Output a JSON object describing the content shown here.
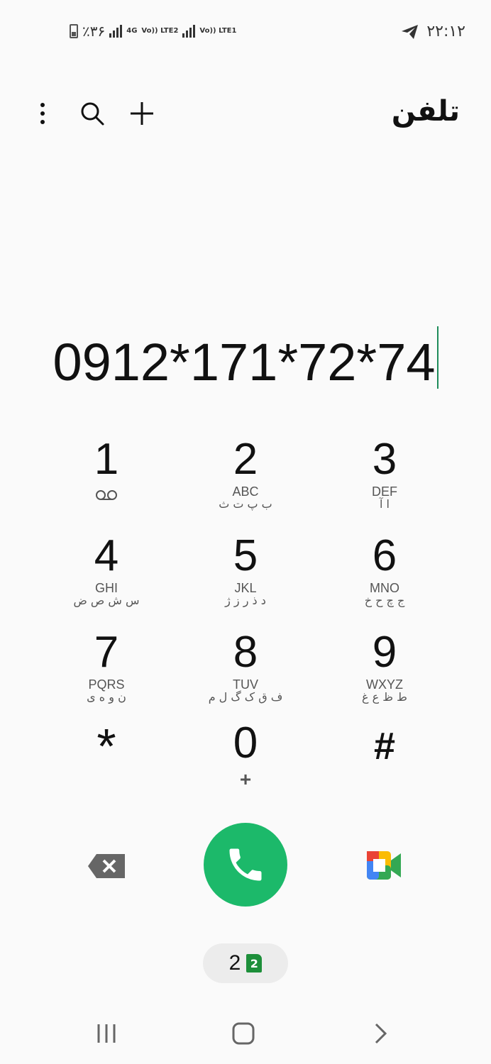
{
  "status_bar": {
    "battery": "٪۳۶",
    "time": "۲۲:۱۲",
    "network": [
      "4G",
      "Vo)) LTE2",
      "Vo)) LTE1"
    ]
  },
  "header": {
    "title": "تلفن",
    "icons": [
      "more-options-icon",
      "search-icon",
      "add-icon"
    ]
  },
  "dialer": {
    "number": "0912*171*72*74"
  },
  "keypad": [
    {
      "digit": "1",
      "latin": "",
      "persian": "",
      "icon": "voicemail-icon"
    },
    {
      "digit": "2",
      "latin": "ABC",
      "persian": "ب پ ت ث"
    },
    {
      "digit": "3",
      "latin": "DEF",
      "persian": "ا آ"
    },
    {
      "digit": "4",
      "latin": "GHI",
      "persian": "س ش ص ض"
    },
    {
      "digit": "5",
      "latin": "JKL",
      "persian": "د ذ ر ز ژ"
    },
    {
      "digit": "6",
      "latin": "MNO",
      "persian": "ج چ ح خ"
    },
    {
      "digit": "7",
      "latin": "PQRS",
      "persian": "ن و ه ی"
    },
    {
      "digit": "8",
      "latin": "TUV",
      "persian": "ف ق ک گ ل م"
    },
    {
      "digit": "9",
      "latin": "WXYZ",
      "persian": "ط ظ ع غ"
    },
    {
      "digit": "*",
      "latin": "",
      "persian": ""
    },
    {
      "digit": "0",
      "latin": "+",
      "persian": ""
    },
    {
      "digit": "#",
      "latin": "",
      "persian": ""
    }
  ],
  "actions": {
    "icons": [
      "backspace-icon",
      "call-icon",
      "video-meet-icon"
    ],
    "call_color": "#1cb96a"
  },
  "sim": {
    "number": "2",
    "badge": "2",
    "badge_color": "#1d8f3a"
  },
  "nav": [
    "recent-apps-icon",
    "home-icon",
    "back-icon"
  ]
}
